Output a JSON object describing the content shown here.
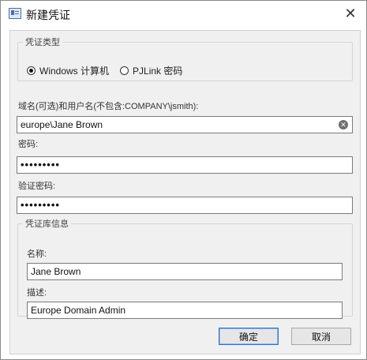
{
  "window": {
    "title": "新建凭证",
    "close_glyph": "✕"
  },
  "credential_type": {
    "legend": "凭证类型",
    "options": [
      {
        "label": "Windows 计算机",
        "selected": true
      },
      {
        "label": "PJLink 密码",
        "selected": false
      }
    ]
  },
  "username": {
    "label": "域名(可选)和用户名(不包含:COMPANY\\jsmith):",
    "value": "europe\\Jane Brown",
    "clear_glyph": "✕"
  },
  "password": {
    "label": "密码:",
    "value": "•••••••••"
  },
  "confirm_password": {
    "label": "验证密码:",
    "value": "•••••••••"
  },
  "credential_info": {
    "legend": "凭证库信息",
    "name_label": "名称:",
    "name_value": "Jane Brown",
    "description_label": "描述:",
    "description_value": "Europe Domain Admin"
  },
  "buttons": {
    "ok": "确定",
    "cancel": "取消"
  }
}
